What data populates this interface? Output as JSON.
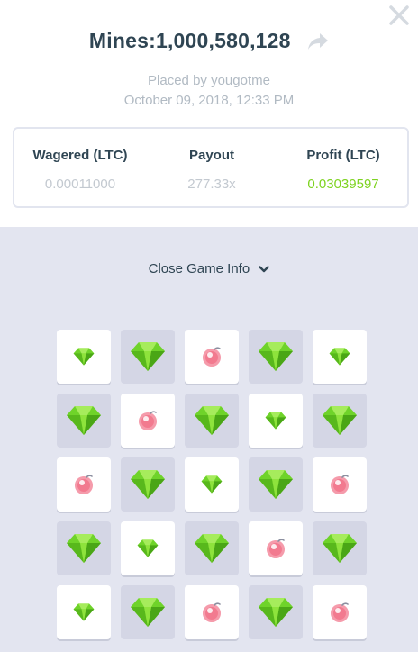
{
  "header": {
    "title": "Mines:1,000,580,128",
    "placed_by": "Placed by yougotme",
    "date": "October 09, 2018, 12:33 PM"
  },
  "stats": [
    {
      "label": "Wagered (LTC)",
      "value": "0.00011000"
    },
    {
      "label": "Payout",
      "value": "277.33x"
    },
    {
      "label": "Profit (LTC)",
      "value": "0.03039597"
    }
  ],
  "toggle": {
    "label": "Close Game Info"
  },
  "colors": {
    "text_dark": "#2f4553",
    "text_muted": "#b1bac3",
    "profit_green": "#7ed321",
    "panel_bg": "#e3e5f0",
    "tile_revealed": "#d4d6e5",
    "tile_unrevealed": "#ffffff",
    "gem": "#6fd32a",
    "mine": "#f27a8f"
  },
  "board": {
    "rows": [
      [
        {
          "c": "gem",
          "r": false
        },
        {
          "c": "gem",
          "r": true
        },
        {
          "c": "mine",
          "r": false
        },
        {
          "c": "gem",
          "r": true
        },
        {
          "c": "gem",
          "r": false
        }
      ],
      [
        {
          "c": "gem",
          "r": true
        },
        {
          "c": "mine",
          "r": false
        },
        {
          "c": "gem",
          "r": true
        },
        {
          "c": "gem",
          "r": false
        },
        {
          "c": "gem",
          "r": true
        }
      ],
      [
        {
          "c": "mine",
          "r": false
        },
        {
          "c": "gem",
          "r": true
        },
        {
          "c": "gem",
          "r": false
        },
        {
          "c": "gem",
          "r": true
        },
        {
          "c": "mine",
          "r": false
        }
      ],
      [
        {
          "c": "gem",
          "r": true
        },
        {
          "c": "gem",
          "r": false
        },
        {
          "c": "gem",
          "r": true
        },
        {
          "c": "mine",
          "r": false
        },
        {
          "c": "gem",
          "r": true
        }
      ],
      [
        {
          "c": "gem",
          "r": false
        },
        {
          "c": "gem",
          "r": true
        },
        {
          "c": "mine",
          "r": false
        },
        {
          "c": "gem",
          "r": true
        },
        {
          "c": "mine",
          "r": false
        }
      ]
    ]
  }
}
